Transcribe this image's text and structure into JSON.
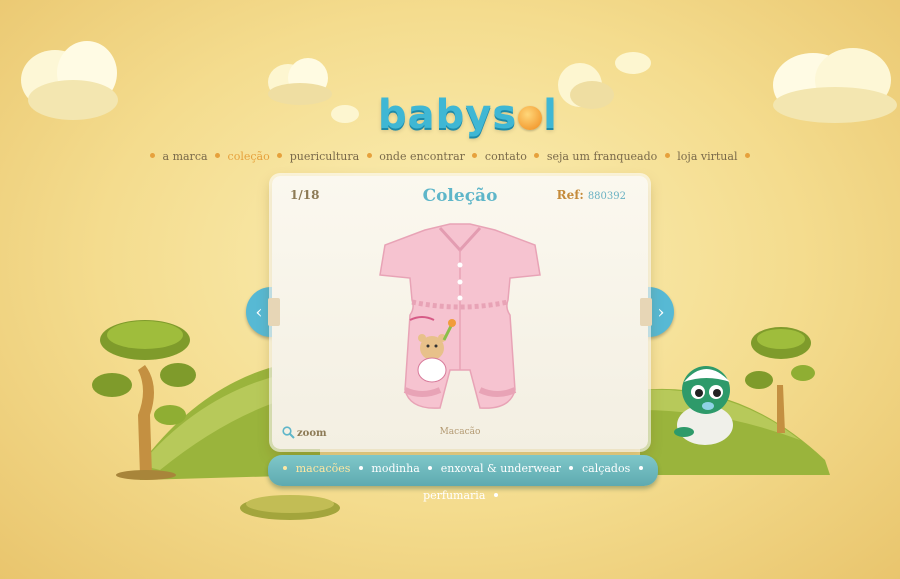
{
  "brand": {
    "name_pre": "babys",
    "name_post": "l"
  },
  "top_nav": [
    {
      "label": "a marca"
    },
    {
      "label": "coleção",
      "active": true
    },
    {
      "label": "puericultura"
    },
    {
      "label": "onde encontrar"
    },
    {
      "label": "contato"
    },
    {
      "label": "seja um franqueado"
    },
    {
      "label": "loja virtual"
    }
  ],
  "gallery": {
    "counter": "1/18",
    "title": "Coleção",
    "ref_label": "Ref:",
    "ref_code": "880392",
    "zoom_label": "zoom",
    "caption": "Macacão"
  },
  "bottom_nav": [
    {
      "label": "macacões",
      "active": true
    },
    {
      "label": "modinha"
    },
    {
      "label": "enxoval & underwear"
    },
    {
      "label": "calçados"
    },
    {
      "label": "perfumaria"
    }
  ],
  "colors": {
    "accent": "#3fb7d4",
    "nav_active": "#e6a13c",
    "teal": "#5eaab0"
  }
}
